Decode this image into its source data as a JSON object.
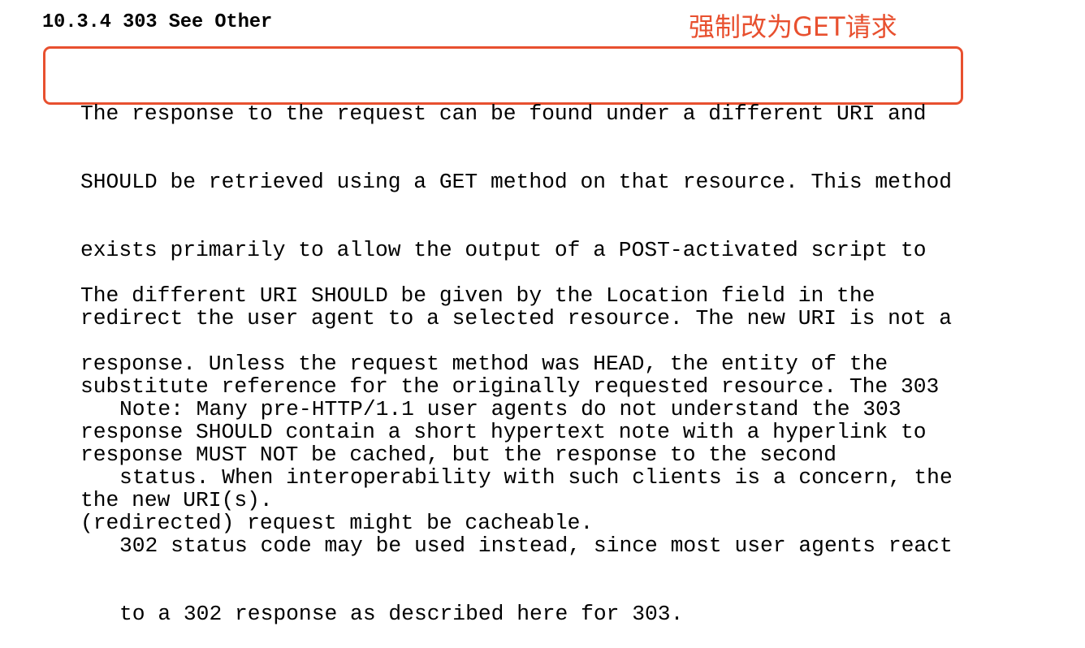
{
  "section": {
    "heading": "10.3.4 303 See Other"
  },
  "annotation": {
    "label": "强制改为GET请求",
    "color": "#e8502f"
  },
  "paragraphs": [
    {
      "lines": [
        "The response to the request can be found under a different URI and",
        "SHOULD be retrieved using a GET method on that resource. This method",
        "exists primarily to allow the output of a POST-activated script to",
        "redirect the user agent to a selected resource. The new URI is not a",
        "substitute reference for the originally requested resource. The 303",
        "response MUST NOT be cached, but the response to the second",
        "(redirected) request might be cacheable."
      ]
    },
    {
      "lines": [
        "The different URI SHOULD be given by the Location field in the",
        "response. Unless the request method was HEAD, the entity of the",
        "response SHOULD contain a short hypertext note with a hyperlink to",
        "the new URI(s)."
      ]
    },
    {
      "lines": [
        "Note: Many pre-HTTP/1.1 user agents do not understand the 303",
        "status. When interoperability with such clients is a concern, the",
        "302 status code may be used instead, since most user agents react",
        "to a 302 response as described here for 303."
      ]
    }
  ]
}
